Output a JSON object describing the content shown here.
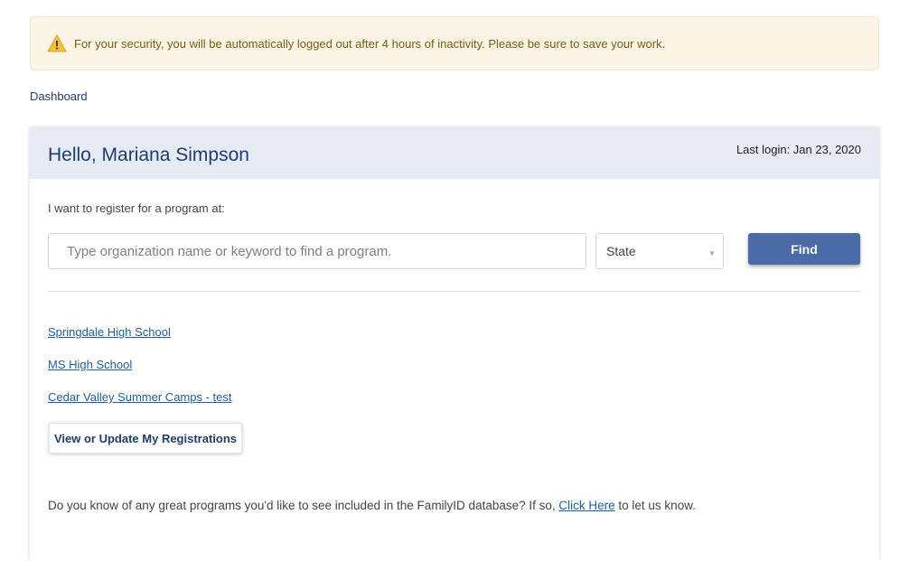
{
  "alert": {
    "icon": "warning-icon",
    "message": "For your security, you will be automatically logged out after 4 hours of inactivity. Please be sure to save your work."
  },
  "breadcrumb": {
    "label": "Dashboard"
  },
  "panel": {
    "greeting": "Hello, Mariana Simpson",
    "last_login": "Last login: Jan 23, 2020",
    "prompt": "I want to register for a program at:",
    "search": {
      "placeholder": "Type organization name or keyword to find a program.",
      "value": ""
    },
    "state_select": {
      "selected": "State"
    },
    "find_label": "Find",
    "organizations": [
      "Springdale High School",
      "MS High School",
      "Cedar Valley Summer Camps - test"
    ],
    "registrations_label": "View or Update My Registrations",
    "footer": {
      "before": "Do you know of any great programs you'd like to see included in the FamilyID database? If so, ",
      "link": "Click Here",
      "after": " to let us know."
    }
  },
  "colors": {
    "accent": "#4a6ba6",
    "header_bg": "#e6ebf3",
    "alert_bg": "#fcf5e6",
    "link": "#1f5fa6"
  }
}
